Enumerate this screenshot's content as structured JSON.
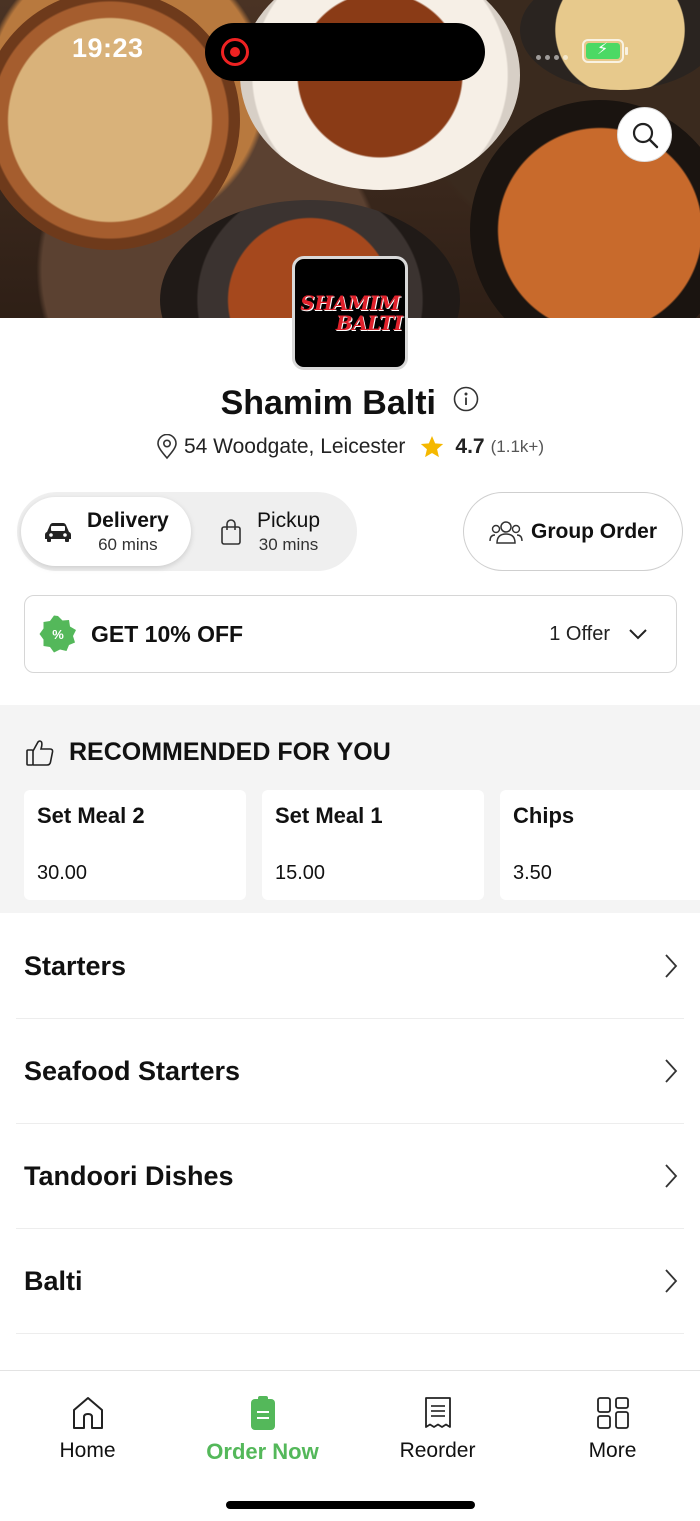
{
  "status_bar": {
    "time": "19:23"
  },
  "restaurant": {
    "logo_text_line1": "SHAMIM",
    "logo_text_line2": "BALTI",
    "name": "Shamim Balti",
    "address": "54 Woodgate, Leicester",
    "rating": "4.7",
    "rating_count": "(1.1k+)"
  },
  "order_modes": {
    "delivery": {
      "label": "Delivery",
      "time": "60 mins",
      "selected": true
    },
    "pickup": {
      "label": "Pickup",
      "time": "30 mins",
      "selected": false
    }
  },
  "group_order": {
    "label": "Group Order"
  },
  "offer": {
    "title": "GET 10% OFF",
    "count": "1 Offer",
    "badge_symbol": "%"
  },
  "recommended": {
    "heading": "RECOMMENDED FOR YOU",
    "items": [
      {
        "name": "Set Meal 2",
        "price": "30.00"
      },
      {
        "name": "Set Meal 1",
        "price": "15.00"
      },
      {
        "name": "Chips",
        "price": "3.50"
      }
    ]
  },
  "categories": [
    {
      "label": "Starters"
    },
    {
      "label": "Seafood Starters"
    },
    {
      "label": "Tandoori Dishes"
    },
    {
      "label": "Balti"
    }
  ],
  "bottom_nav": [
    {
      "label": "Home",
      "icon": "home-icon"
    },
    {
      "label": "Order Now",
      "icon": "order-icon",
      "active": true
    },
    {
      "label": "Reorder",
      "icon": "receipt-icon"
    },
    {
      "label": "More",
      "icon": "grid-icon"
    }
  ],
  "colors": {
    "accent": "#54b85a",
    "star": "#f5b800",
    "logo_red": "#e0212b"
  }
}
